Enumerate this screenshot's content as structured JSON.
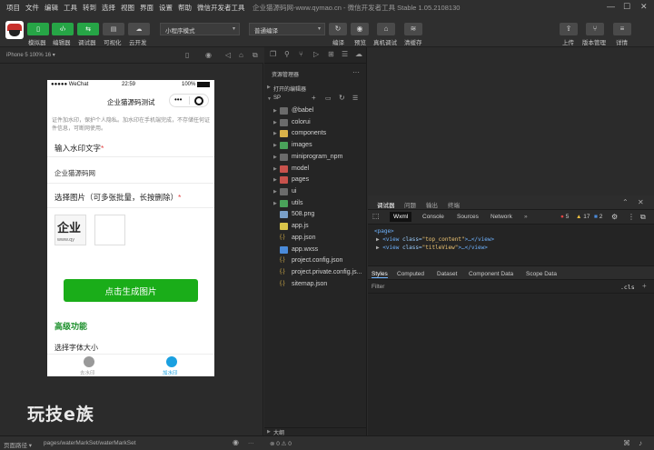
{
  "menubar": {
    "items": [
      "项目",
      "文件",
      "编辑",
      "工具",
      "转到",
      "选择",
      "视图",
      "界面",
      "设置",
      "帮助",
      "微信开发者工具"
    ],
    "title": "企业猫源码网-www.qymao.cn - 微信开发者工具 Stable 1.05.2108130"
  },
  "toolbar": {
    "simulator": "模拟器",
    "editor": "编辑器",
    "debugger": "调试器",
    "visual": "可视化",
    "cloud": "云开发",
    "mode_select": "小程序模式",
    "compile_select": "普通编译",
    "compile": "编译",
    "preview": "预览",
    "real_debug": "真机调试",
    "clear_cache": "清缓存",
    "upload": "上传",
    "version": "版本管理",
    "details": "详情"
  },
  "simulator": {
    "device": "iPhone 5 100% 16 ▾"
  },
  "phone": {
    "status_carrier": "●●●●● WeChat",
    "status_time": "22:59",
    "status_battery": "100%",
    "nav_title": "企业猫源码测试",
    "notice": "证件加水印，保护个人隐私。加水印在手机端完成，不存储任何证件信息，可断网使用。",
    "watermark_label": "输入水印文字",
    "required_mark": "*",
    "watermark_value": "企业猫源码网",
    "image_label": "选择图片（可多张批量，长按删除）",
    "thumb_text": "企业",
    "thumb_url": "www.qy",
    "generate_button": "点击生成图片",
    "advanced_title": "高级功能",
    "font_size_label": "选择字体大小",
    "tab1": "去水印",
    "tab2": "加水印"
  },
  "brand_watermark": "玩技e族",
  "explorer": {
    "title": "资源管理器",
    "open_editors": "打开的编辑器",
    "project": "SP",
    "tree": [
      {
        "name": "@babel",
        "type": "folder"
      },
      {
        "name": "colorui",
        "type": "folder"
      },
      {
        "name": "components",
        "type": "folder-yellow"
      },
      {
        "name": "images",
        "type": "folder-green"
      },
      {
        "name": "miniprogram_npm",
        "type": "folder"
      },
      {
        "name": "model",
        "type": "folder-red"
      },
      {
        "name": "pages",
        "type": "folder-red"
      },
      {
        "name": "ui",
        "type": "folder"
      },
      {
        "name": "utils",
        "type": "folder-green"
      },
      {
        "name": "508.png",
        "type": "img"
      },
      {
        "name": "app.js",
        "type": "js"
      },
      {
        "name": "app.json",
        "type": "json"
      },
      {
        "name": "app.wxss",
        "type": "css"
      },
      {
        "name": "project.config.json",
        "type": "json"
      },
      {
        "name": "project.private.config.js...",
        "type": "json"
      },
      {
        "name": "sitemap.json",
        "type": "json"
      }
    ],
    "outline": "大纲"
  },
  "devtools": {
    "tabs": [
      "调试器",
      "问题",
      "输出",
      "终端"
    ],
    "panels": [
      "Wxml",
      "Console",
      "Sources",
      "Network"
    ],
    "errors": "5",
    "warnings": "17",
    "infos": "2",
    "code_line1": "<page>",
    "code_line2_tag": "<view",
    "code_line2_attr": "class=",
    "code_line2_val": "\"top_content\"",
    "code_line2_rest": ">…</view>",
    "code_line3_tag": "<view",
    "code_line3_attr": "class=",
    "code_line3_val": "\"titleView\"",
    "code_line3_rest": ">…</view>",
    "style_tabs": [
      "Styles",
      "Computed",
      "Dataset",
      "Component Data",
      "Scope Data"
    ],
    "filter_placeholder": "Filter",
    "cls": ".cls"
  },
  "statusbar": {
    "path_label": "页面路径 ▾",
    "path": "pages/waterMarkSet/waterMarkSet",
    "counts": "⊗ 0 ⚠ 0"
  }
}
